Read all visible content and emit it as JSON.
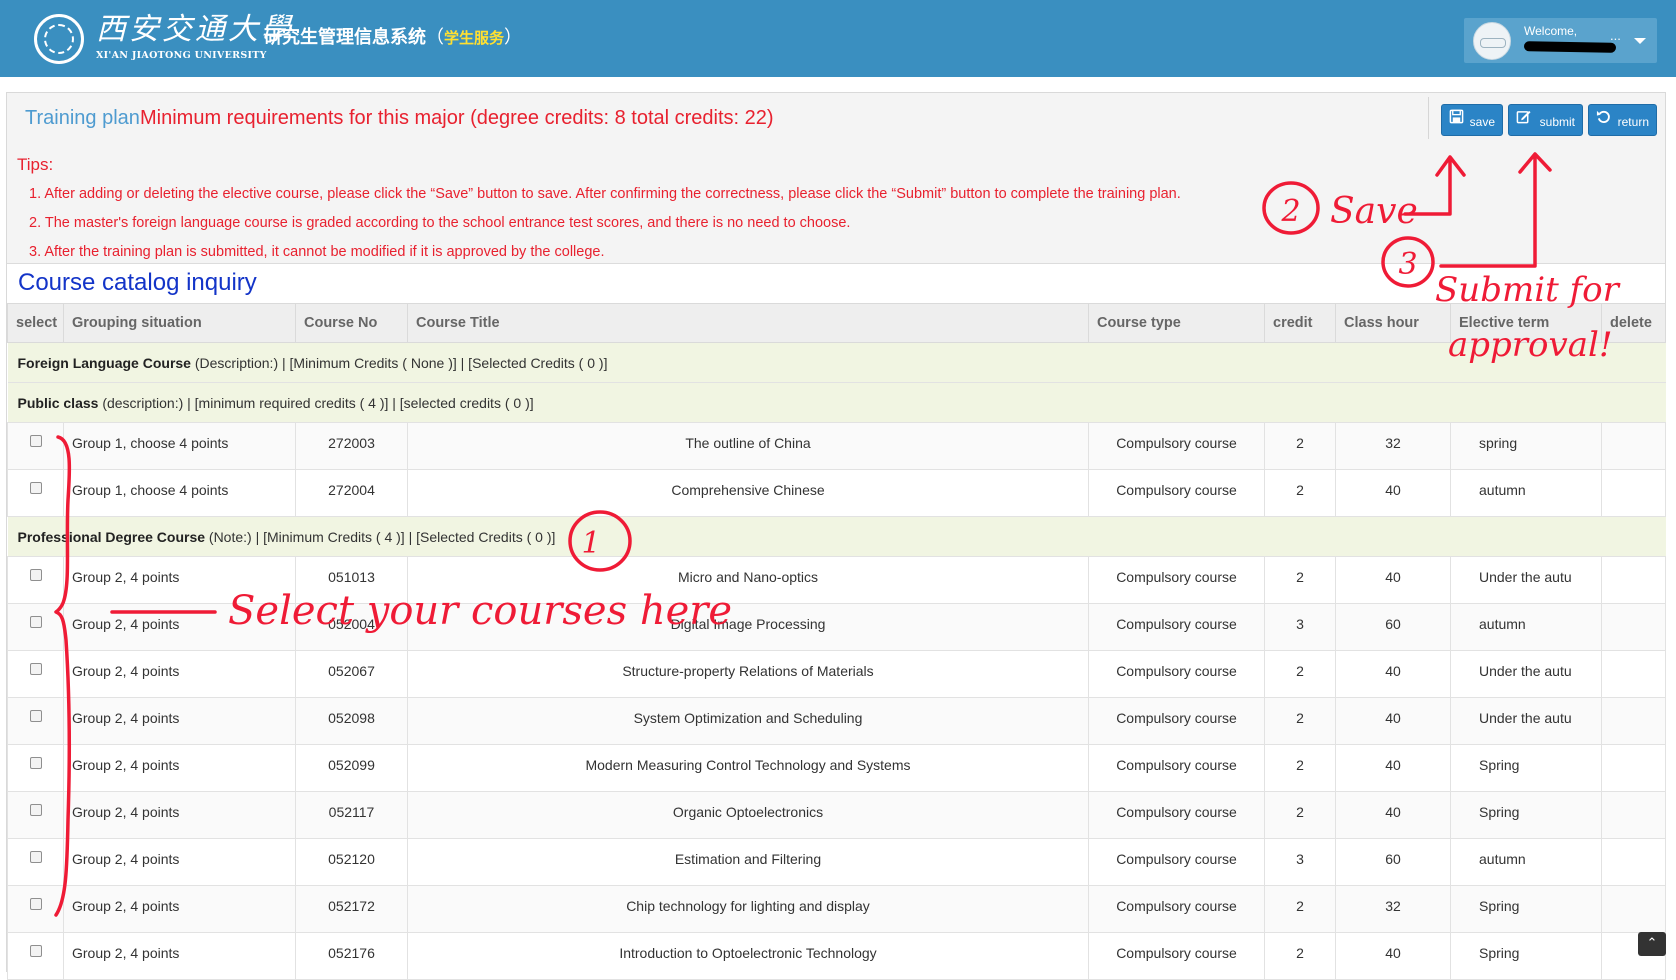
{
  "header": {
    "logo_cn": "西安交通大學",
    "logo_en": "XI'AN JIAOTONG UNIVERSITY",
    "system_name": "研究生管理信息系统",
    "paren_open": "（",
    "system_sub": "学生服务",
    "paren_close": "）",
    "welcome": "Welcome,",
    "user_ellipsis": "..."
  },
  "plan": {
    "label": "Training plan",
    "requirement": "Minimum requirements for this major (degree credits: 8 total credits: 22)",
    "buttons": {
      "save": "save",
      "submit": "submit",
      "return": "return"
    }
  },
  "tips": {
    "title": "Tips:",
    "items": [
      "1. After adding or deleting the elective course, please click the “Save” button to save. After confirming the correctness, please click the “Submit” button to complete the training plan.",
      "2. The master's foreign language course is graded according to the school entrance test scores, and there is no need to choose.",
      "3. After the training plan is submitted, it cannot be modified if it is approved by the college."
    ]
  },
  "catalog": {
    "title": "Course catalog inquiry",
    "columns": [
      "select",
      "Grouping situation",
      "Course No",
      "Course Title",
      "Course type",
      "credit",
      "Class hour",
      "Elective term",
      "delete"
    ],
    "groups": [
      {
        "name": "Foreign Language Course",
        "detail": " (Description:) | [Minimum Credits ( None )] | [Selected Credits ( 0 )]",
        "rows": []
      },
      {
        "name": "Public class",
        "detail": " (description:) | [minimum required credits ( 4 )] | [selected credits ( 0 )]",
        "rows": [
          {
            "group": "Group 1, choose 4 points",
            "no": "272003",
            "title": "The outline of China",
            "type": "Compulsory course",
            "credit": "2",
            "hours": "32",
            "term": "spring"
          },
          {
            "group": "Group 1, choose 4 points",
            "no": "272004",
            "title": "Comprehensive Chinese",
            "type": "Compulsory course",
            "credit": "2",
            "hours": "40",
            "term": "autumn"
          }
        ]
      },
      {
        "name": "Professional Degree Course",
        "detail": " (Note:) | [Minimum Credits ( 4 )] | [Selected Credits ( 0 )]",
        "rows": [
          {
            "group": "Group 2, 4 points",
            "no": "051013",
            "title": "Micro and Nano-optics",
            "type": "Compulsory course",
            "credit": "2",
            "hours": "40",
            "term": "Under the autu"
          },
          {
            "group": "Group 2, 4 points",
            "no": "052004",
            "title": "Digital Image Processing",
            "type": "Compulsory course",
            "credit": "3",
            "hours": "60",
            "term": "autumn"
          },
          {
            "group": "Group 2, 4 points",
            "no": "052067",
            "title": "Structure-property Relations of Materials",
            "type": "Compulsory course",
            "credit": "2",
            "hours": "40",
            "term": "Under the autu"
          },
          {
            "group": "Group 2, 4 points",
            "no": "052098",
            "title": "System Optimization and Scheduling",
            "type": "Compulsory course",
            "credit": "2",
            "hours": "40",
            "term": "Under the autu"
          },
          {
            "group": "Group 2, 4 points",
            "no": "052099",
            "title": "Modern Measuring Control Technology and Systems",
            "type": "Compulsory course",
            "credit": "2",
            "hours": "40",
            "term": "Spring"
          },
          {
            "group": "Group 2, 4 points",
            "no": "052117",
            "title": "Organic Optoelectronics",
            "type": "Compulsory course",
            "credit": "2",
            "hours": "40",
            "term": "Spring"
          },
          {
            "group": "Group 2, 4 points",
            "no": "052120",
            "title": "Estimation and Filtering",
            "type": "Compulsory course",
            "credit": "3",
            "hours": "60",
            "term": "autumn"
          },
          {
            "group": "Group 2, 4 points",
            "no": "052172",
            "title": "Chip technology for lighting and display",
            "type": "Compulsory course",
            "credit": "2",
            "hours": "32",
            "term": "Spring"
          },
          {
            "group": "Group 2, 4 points",
            "no": "052176",
            "title": "Introduction to Optoelectronic Technology",
            "type": "Compulsory course",
            "credit": "2",
            "hours": "40",
            "term": "Spring"
          }
        ]
      }
    ]
  },
  "annotations": {
    "step1": "1",
    "select_text": "Select your courses here",
    "step2": "2",
    "save_text": "Save",
    "step3": "3",
    "submit_text": "Submit for",
    "approval_text": "approval!"
  },
  "scroll_top_icon": "double-chevron-up-icon",
  "colors": {
    "topbar": "#3a8fc0",
    "primary_button": "#2b84c6",
    "alert_red": "#e8212f",
    "catalog_title": "#1334c8",
    "group_row_bg": "#f1f5e2",
    "annotation_red": "#ef1b36"
  }
}
